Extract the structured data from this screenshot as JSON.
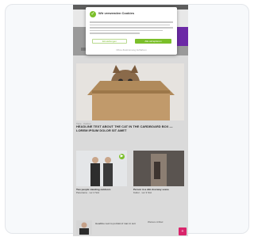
{
  "consent_dialog": {
    "title": "Wir verwenden Cookies",
    "body_lines": 5,
    "secondary_button": "Einstellungen",
    "primary_button": "Alle akzeptieren",
    "footer_link": "Ohne Zustimmung fortfahren"
  },
  "hero_article": {
    "meta": "Tiere · Katzen",
    "title": "HEADLINE TEXT ABOUT THE CAT IN THE CARDBOARD BOX — LOREM IPSUM DOLOR SIT AMET"
  },
  "tiles": [
    {
      "headline": "Two people standing outdoors",
      "meta": "Panorama · vor 2 Std."
    },
    {
      "headline": "Person in a dim doorway scene",
      "meta": "Kultur · vor 3 Std."
    }
  ],
  "bottom_row": {
    "text": "Headline next to portrait of man in suit",
    "sidebar": "Weitere Artikel"
  },
  "colors": {
    "accent_green": "#7bbf2a",
    "brand_purple": "#6c2aa6",
    "tag_pink": "#d9246b"
  },
  "icons": {
    "dialog_logo": "check-circle-icon",
    "tile_badge": "play-icon",
    "bottom_tag": "plus-icon"
  }
}
